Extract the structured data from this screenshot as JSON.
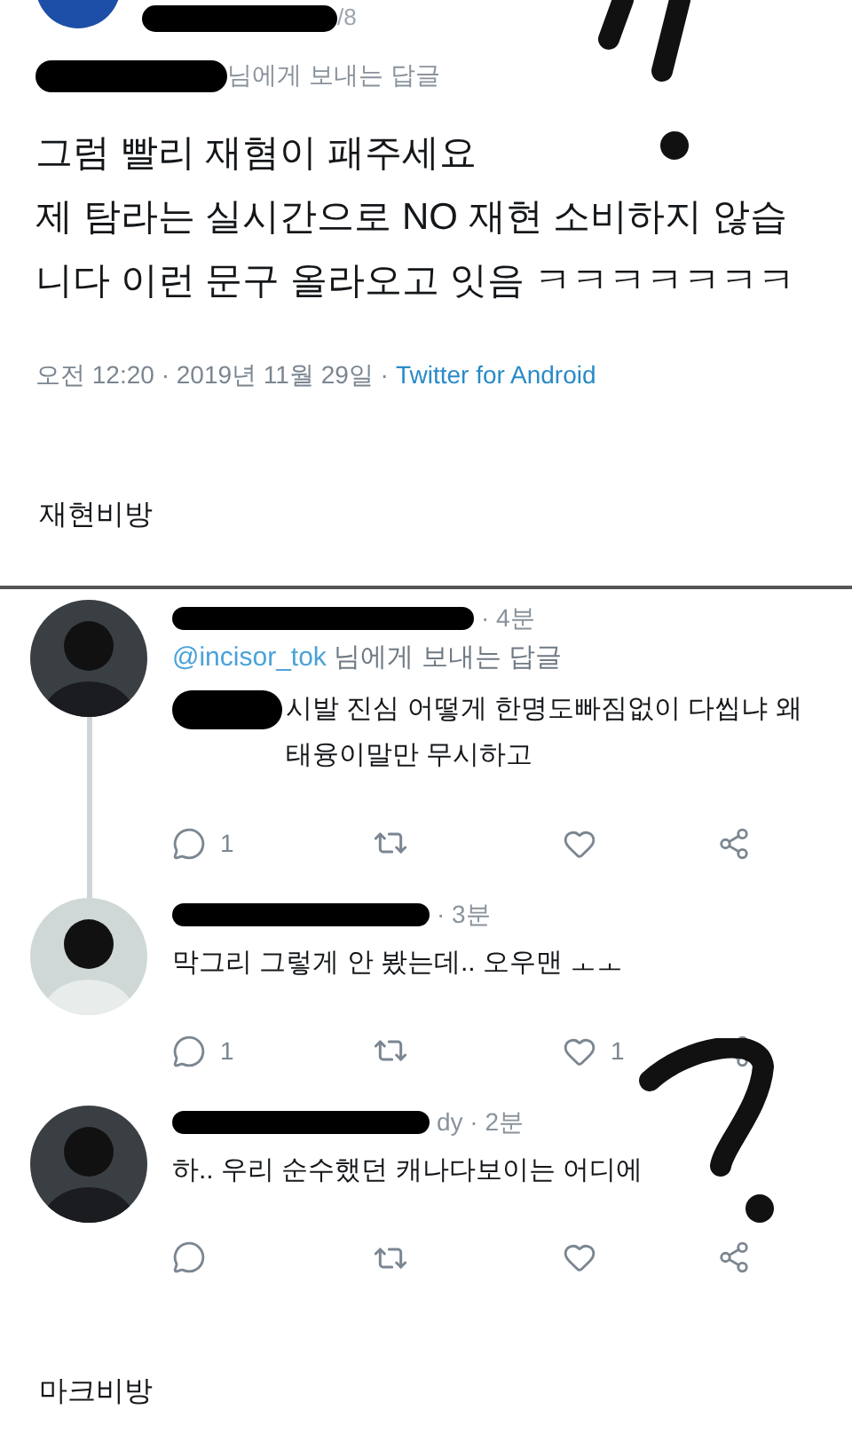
{
  "detail_tweet": {
    "name_suffix": "/8",
    "reply_label": "님에게 보내는 답글",
    "text": "그럼 빨리 재혐이 패주세요\n제 탐라는 실시간으로 NO 재현 소비하지 않습니다 이런 문구 올라오고 잇음 ㅋㅋㅋㅋㅋㅋㅋ",
    "timestamp": "오전 12:20 · 2019년 11월 29일 ·",
    "source": "Twitter for Android"
  },
  "caption_1": "재현비방",
  "thread": [
    {
      "meta": "· 4분",
      "reply_to": "@incisor_tok",
      "reply_label": "님에게 보내는 답글",
      "text": "시발 진심 어떻게 한명도빠짐없이 다씹냐 왜 태융이말만 무시하고",
      "text_redacted": true,
      "reply_count": "1",
      "thread_line": true
    },
    {
      "meta": "· 3분",
      "text": "막그리 그렇게 안 봤는데.. 오우맨 ㅗㅗ",
      "text_redacted": false,
      "reply_count": "1",
      "like_count": "1",
      "thread_line": false
    },
    {
      "meta": "dy · 2분",
      "text": "하.. 우리 순수했던 캐나다보이는 어디에",
      "text_redacted": false,
      "thread_line": false
    }
  ],
  "caption_2": "마크비방"
}
